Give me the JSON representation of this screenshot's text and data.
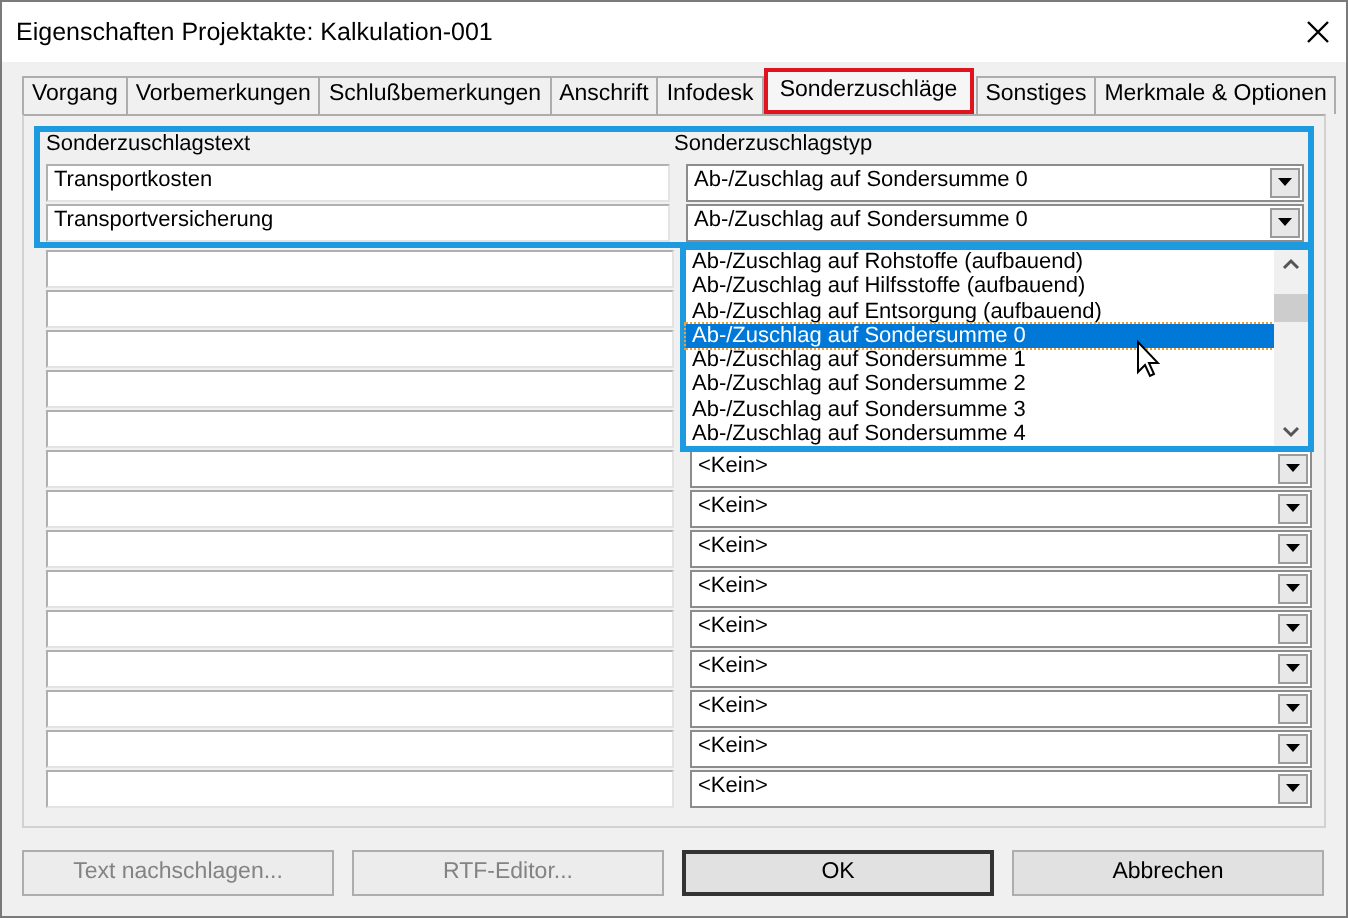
{
  "window": {
    "title": "Eigenschaften Projektakte: Kalkulation-001"
  },
  "tabs": [
    {
      "label": "Vorgang",
      "selected": false
    },
    {
      "label": "Vorbemerkungen",
      "selected": false
    },
    {
      "label": "Schlußbemerkungen",
      "selected": false
    },
    {
      "label": "Anschrift",
      "selected": false
    },
    {
      "label": "Infodesk",
      "selected": false
    },
    {
      "label": "Sonderzuschläge",
      "selected": true
    },
    {
      "label": "Sonstiges",
      "selected": false
    },
    {
      "label": "Merkmale & Optionen",
      "selected": false
    }
  ],
  "columns": [
    "Sonderzuschlagstext",
    "Sonderzuschlagstyp"
  ],
  "rows": [
    {
      "text": "Transportkosten",
      "type": "Ab-/Zuschlag auf Sondersumme 0"
    },
    {
      "text": "Transportversicherung",
      "type": "Ab-/Zuschlag auf Sondersumme 0"
    },
    {},
    {},
    {},
    {},
    {},
    {
      "type": "<Kein>"
    },
    {
      "type": "<Kein>"
    },
    {
      "type": "<Kein>"
    },
    {
      "type": "<Kein>"
    },
    {
      "type": "<Kein>"
    },
    {
      "type": "<Kein>"
    },
    {
      "type": "<Kein>"
    },
    {
      "type": "<Kein>"
    },
    {
      "type": "<Kein>"
    }
  ],
  "dropdown_list": [
    {
      "label": "Ab-/Zuschlag auf Rohstoffe (aufbauend)",
      "selected": false
    },
    {
      "label": "Ab-/Zuschlag auf Hilfsstoffe (aufbauend)",
      "selected": false
    },
    {
      "label": "Ab-/Zuschlag auf Entsorgung (aufbauend)",
      "selected": false
    },
    {
      "label": "Ab-/Zuschlag auf Sondersumme 0",
      "selected": true
    },
    {
      "label": "Ab-/Zuschlag auf Sondersumme 1",
      "selected": false
    },
    {
      "label": "Ab-/Zuschlag auf Sondersumme 2",
      "selected": false
    },
    {
      "label": "Ab-/Zuschlag auf Sondersumme 3",
      "selected": false
    },
    {
      "label": "Ab-/Zuschlag auf Sondersumme 4",
      "selected": false
    }
  ],
  "buttons": [
    {
      "label": "Text nachschlagen...",
      "disabled": true,
      "default": false
    },
    {
      "label": "RTF-Editor...",
      "disabled": true,
      "default": false
    },
    {
      "label": "OK",
      "disabled": false,
      "default": true
    },
    {
      "label": "Abbrechen",
      "disabled": false,
      "default": false
    }
  ]
}
